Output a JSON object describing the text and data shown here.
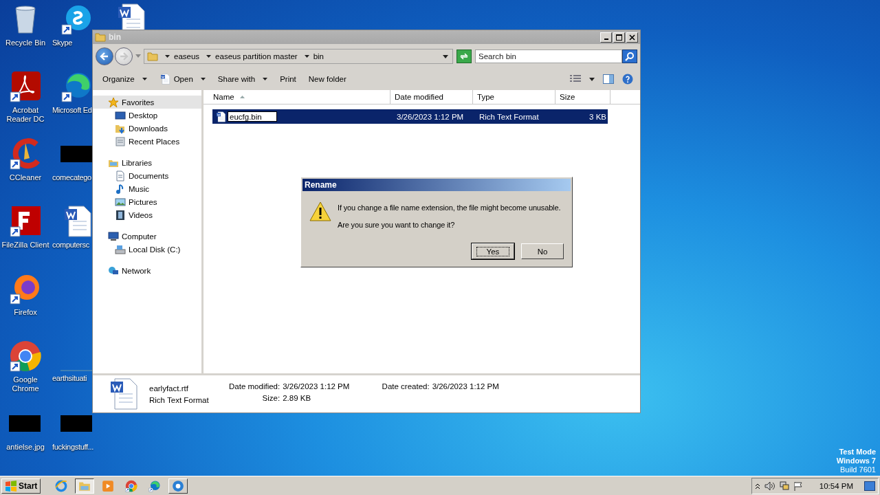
{
  "desktop": {
    "icon_columns": [
      {
        "icons": [
          {
            "kind": "recycle",
            "label": "Recycle Bin"
          },
          {
            "kind": "acrobat",
            "label": "Acrobat Reader DC"
          },
          {
            "kind": "ccleaner",
            "label": "CCleaner"
          },
          {
            "kind": "filezilla",
            "label": "FileZilla Client"
          },
          {
            "kind": "firefox",
            "label": "Firefox"
          },
          {
            "kind": "chrome",
            "label": "Google Chrome"
          },
          {
            "kind": "thumb",
            "label": "antielse.jpg"
          }
        ]
      },
      {
        "icons": [
          {
            "kind": "skype",
            "label": "Skype"
          },
          {
            "kind": "edge",
            "label": "Microsoft Ed"
          },
          {
            "kind": "thumb",
            "label": "comecatego"
          },
          {
            "kind": "word",
            "label": "computersc"
          },
          {
            "kind": "none"
          },
          {
            "kind": "line",
            "label": "earthsituati"
          },
          {
            "kind": "thumb",
            "label": "fuckingstuff..."
          }
        ]
      },
      {
        "icons": [
          {
            "kind": "word"
          }
        ]
      }
    ],
    "os_notice": [
      "Test Mode",
      "Windows 7",
      "Build 7601"
    ]
  },
  "explorer": {
    "title": "bin",
    "path": [
      "easeus",
      "easeus partition master",
      "bin"
    ],
    "search": {
      "placeholder": "Search bin"
    },
    "toolbar": [
      {
        "label": "Organize",
        "kind": "plain",
        "dropdown": true
      },
      {
        "label": "Open",
        "kind": "document",
        "dropdown": true
      },
      {
        "label": "Share with",
        "kind": "plain",
        "dropdown": true
      },
      {
        "label": "Print",
        "kind": "plain",
        "dropdown": false
      },
      {
        "label": "New folder",
        "kind": "plain",
        "dropdown": false
      }
    ],
    "nav": [
      {
        "label": "Favorites",
        "kind": "star",
        "selected": true,
        "children": [
          {
            "label": "Desktop",
            "kind": "desktop",
            "selected": false
          },
          {
            "label": "Downloads",
            "kind": "downloads",
            "selected": false
          },
          {
            "label": "Recent Places",
            "kind": "recent",
            "selected": false
          }
        ]
      },
      {
        "label": "Libraries",
        "kind": "libraries",
        "selected": false,
        "children": [
          {
            "label": "Documents",
            "kind": "documents",
            "selected": false
          },
          {
            "label": "Music",
            "kind": "music",
            "selected": false
          },
          {
            "label": "Pictures",
            "kind": "pictures",
            "selected": false
          },
          {
            "label": "Videos",
            "kind": "videos",
            "selected": false
          }
        ]
      },
      {
        "label": "Computer",
        "kind": "computer",
        "selected": false,
        "children": [
          {
            "label": "Local Disk (C:)",
            "kind": "disk",
            "selected": false
          }
        ]
      },
      {
        "label": "Network",
        "kind": "network",
        "selected": false
      }
    ],
    "columns": [
      {
        "label": "Name",
        "sorted": true
      },
      {
        "label": "Date modified",
        "sorted": false
      },
      {
        "label": "Type",
        "sorted": false
      },
      {
        "label": "Size",
        "sorted": false
      }
    ],
    "rows": [
      {
        "name": "eucfg.bin",
        "editing": true,
        "date": "3/26/2023 1:12 PM",
        "type": "Rich Text Format",
        "size": "3 KB",
        "selected": true
      }
    ],
    "details": {
      "name": "earlyfact.rtf",
      "type": "Rich Text Format",
      "columns": [
        [
          {
            "label": "Date modified:",
            "value": "3/26/2023 1:12 PM"
          },
          {
            "label": "Size:",
            "value": "2.89 KB"
          }
        ],
        [
          {
            "label": "Date created:",
            "value": "3/26/2023 1:12 PM"
          }
        ]
      ]
    }
  },
  "dialog": {
    "title": "Rename",
    "message": [
      "If you change a file name extension, the file might become unusable.",
      "Are you sure you want to change it?"
    ],
    "buttons": [
      {
        "label": "Yes",
        "default": true
      },
      {
        "label": "No",
        "default": false
      }
    ]
  },
  "taskbar": {
    "start": "Start",
    "apps": [
      {
        "kind": "ie",
        "selected": false
      },
      {
        "kind": "explorer",
        "selected": true
      },
      {
        "kind": "media",
        "selected": false
      },
      {
        "kind": "chrome",
        "selected": false
      },
      {
        "kind": "edge",
        "selected": false
      },
      {
        "kind": "app",
        "selected": false
      }
    ],
    "clock": "10:54 PM"
  }
}
